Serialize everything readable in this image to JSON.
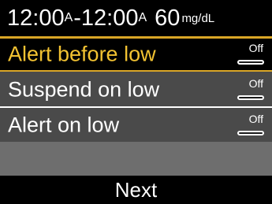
{
  "header": {
    "start_time": "12:00",
    "start_ampm": "A",
    "separator": "-",
    "end_time": "12:00",
    "end_ampm": "A",
    "glucose_value": "60",
    "glucose_unit": "mg/dL"
  },
  "settings": [
    {
      "label": "Alert before low",
      "state": "Off",
      "selected": true
    },
    {
      "label": "Suspend on low",
      "state": "Off",
      "selected": false
    },
    {
      "label": "Alert on low",
      "state": "Off",
      "selected": false
    }
  ],
  "footer": {
    "next_label": "Next"
  },
  "colors": {
    "highlight_border": "#d9a626",
    "highlight_text": "#f2c232",
    "row_background": "#4a4a4a",
    "screen_background": "#6e6e6e"
  }
}
